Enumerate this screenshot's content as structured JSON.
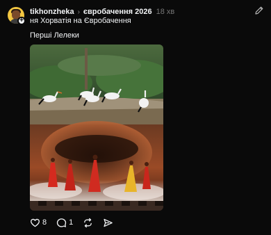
{
  "post": {
    "author": "tikhonzheka",
    "topic": "євробачення 2026",
    "time": "18 хв",
    "text_line1": "ня Хорватія на Євробачення",
    "text_line2": "Перші Лелеки",
    "media_alt": "storks on a nest above dancers in red dresses on a stage"
  },
  "actions": {
    "likes": "8",
    "replies": "1"
  },
  "colors": {
    "background": "#0a0a0a",
    "text": "#f3f5f7",
    "muted": "#777777"
  },
  "icons": {
    "avatar_badge": "plus-icon",
    "edit": "edit-pencil-icon",
    "like": "heart-icon",
    "reply": "comment-icon",
    "repost": "repost-icon",
    "share": "send-icon"
  }
}
